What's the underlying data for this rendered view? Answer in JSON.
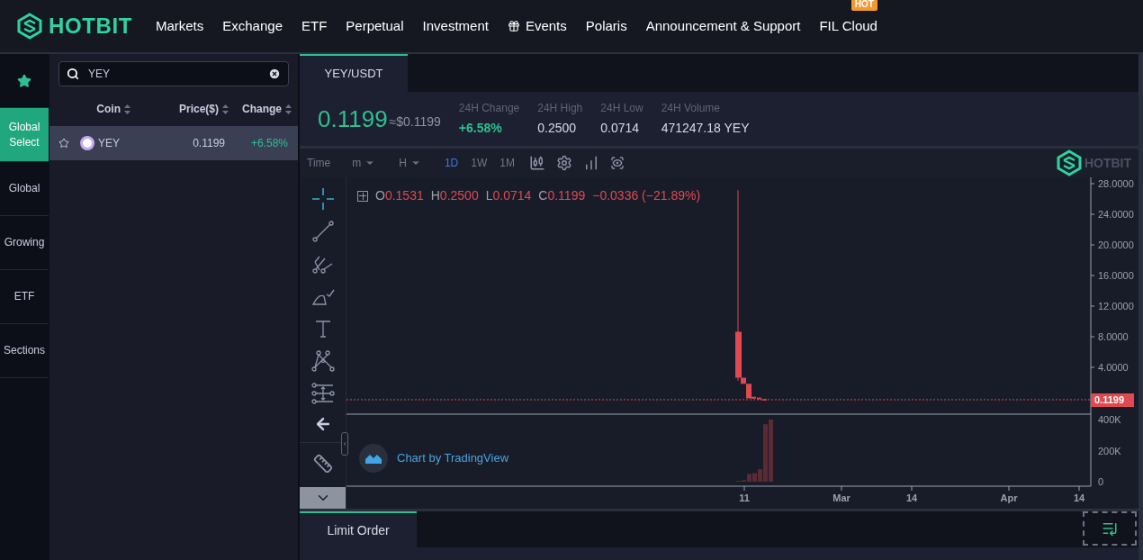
{
  "header": {
    "logo": "HOTBIT",
    "nav": [
      {
        "label": "Markets",
        "kind": "plain"
      },
      {
        "label": "Exchange",
        "kind": "plain"
      },
      {
        "label": "ETF",
        "kind": "plain"
      },
      {
        "label": "Perpetual",
        "kind": "plain"
      },
      {
        "label": "Investment",
        "kind": "plain"
      },
      {
        "label": "Events",
        "kind": "gift"
      },
      {
        "label": "Polaris",
        "kind": "plain"
      },
      {
        "label": "Announcement & Support",
        "kind": "plain"
      },
      {
        "label": "FIL Cloud",
        "kind": "plain",
        "badge": "HOT"
      }
    ]
  },
  "categories": [
    {
      "kind": "star",
      "selected": false
    },
    {
      "label": "Global Select",
      "kind": "text",
      "selected": true
    },
    {
      "label": "Global",
      "kind": "text",
      "selected": false
    },
    {
      "label": "Growing",
      "kind": "text",
      "selected": false
    },
    {
      "label": "ETF",
      "kind": "text",
      "selected": false
    },
    {
      "label": "Sections",
      "kind": "text",
      "selected": false
    }
  ],
  "search": {
    "value": "YEY"
  },
  "coin_table": {
    "columns": [
      "Coin",
      "Price($)",
      "Change"
    ],
    "rows": [
      {
        "coin": "YEY",
        "price": "0.1199",
        "change": "+6.58%",
        "selected": true
      }
    ]
  },
  "pair_tabs": [
    {
      "label": "YEY/USDT",
      "selected": true
    }
  ],
  "ticker": {
    "price": "0.1199",
    "approx": "≈$0.1199",
    "stats": [
      {
        "label": "24H Change",
        "value": "+6.58%",
        "kind": "up"
      },
      {
        "label": "24H High",
        "value": "0.2500",
        "kind": "plain"
      },
      {
        "label": "24H Low",
        "value": "0.0714",
        "kind": "plain"
      },
      {
        "label": "24H Volume",
        "value": "471247.18 YEY",
        "kind": "plain"
      }
    ]
  },
  "toolbar": {
    "items": [
      {
        "label": "Time",
        "kind": "text",
        "selected": false
      },
      {
        "label": "m",
        "kind": "dropdown",
        "selected": false
      },
      {
        "label": "H",
        "kind": "dropdown",
        "selected": false
      },
      {
        "label": "1D",
        "kind": "text",
        "selected": true
      },
      {
        "label": "1W",
        "kind": "text",
        "selected": false
      },
      {
        "label": "1M",
        "kind": "text",
        "selected": false
      }
    ],
    "chart_logo": "HOTBIT"
  },
  "legend": {
    "items": [
      {
        "key": "O",
        "value": "0.1531"
      },
      {
        "key": "H",
        "value": "0.2500"
      },
      {
        "key": "L",
        "value": "0.0714"
      },
      {
        "key": "C",
        "value": "0.1199"
      }
    ],
    "change": "−0.0336 (−21.89%)"
  },
  "price_axis": [
    "28.0000",
    "24.0000",
    "20.0000",
    "16.0000",
    "12.0000",
    "8.0000",
    "4.0000"
  ],
  "last_price": "0.1199",
  "volume_axis": [
    "400K",
    "200K",
    "0"
  ],
  "time_axis": [
    "11",
    "Mar",
    "14",
    "Apr",
    "14"
  ],
  "attribution": "Chart by TradingView",
  "order_tabs": [
    {
      "label": "Limit Order",
      "selected": true
    }
  ],
  "order_panel_toggle": {
    "focused": true
  }
}
